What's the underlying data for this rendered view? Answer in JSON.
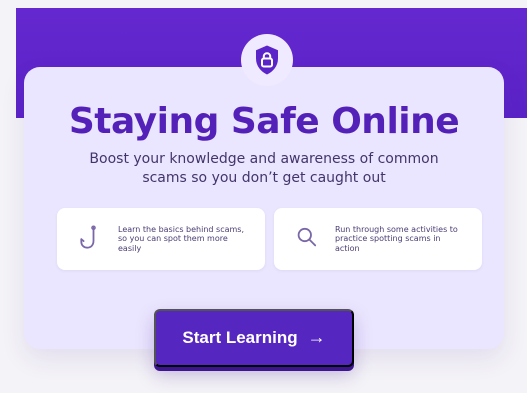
{
  "hero": {
    "title": "Staying Safe Online",
    "subtitle": "Boost your knowledge and awareness of common scams so you don’t get caught out"
  },
  "cards": [
    {
      "text": "Learn the basics behind scams, so you can spot them more easily",
      "icon": "fishing-hook-icon"
    },
    {
      "text": "Run through some activities to practice spotting scams in action",
      "icon": "magnifying-glass-icon"
    }
  ],
  "button": {
    "label": "Start Learning",
    "arrow": "→"
  },
  "theme": {
    "primary": "#5421B8",
    "card_background": "#EBE6FF",
    "band_background": "#6528D0",
    "button_background": "#5626C0",
    "text": "#43356A",
    "white": "#FFFFFF"
  },
  "icons": {
    "badge": "shield-lock-icon"
  }
}
